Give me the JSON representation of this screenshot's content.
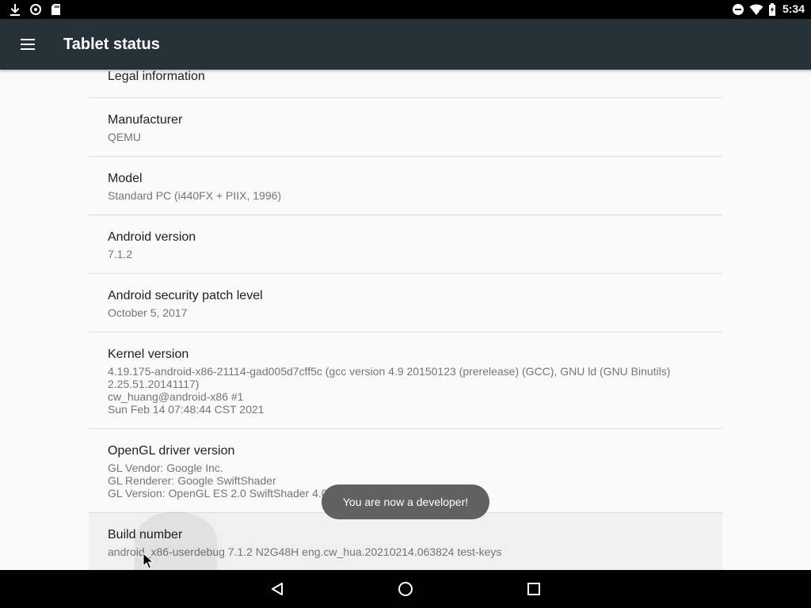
{
  "status_bar": {
    "time": "5:34",
    "left_icons": [
      "download-icon",
      "sync-icon",
      "sd-card-icon"
    ],
    "right_icons": [
      "do-not-disturb-icon",
      "wifi-icon",
      "battery-icon"
    ]
  },
  "toolbar": {
    "title": "Tablet status",
    "menu_icon": "hamburger-menu-icon"
  },
  "settings": [
    {
      "title": "Legal information",
      "summary": ""
    },
    {
      "title": "Manufacturer",
      "summary": "QEMU"
    },
    {
      "title": "Model",
      "summary": "Standard PC (i440FX + PIIX, 1996)"
    },
    {
      "title": "Android version",
      "summary": "7.1.2"
    },
    {
      "title": "Android security patch level",
      "summary": "October 5, 2017"
    },
    {
      "title": "Kernel version",
      "summary": "4.19.175-android-x86-21114-gad005d7cff5c (gcc version 4.9 20150123 (prerelease) (GCC), GNU ld (GNU Binutils)\n2.25.51.20141117)\ncw_huang@android-x86 #1\nSun Feb 14 07:48:44 CST 2021"
    },
    {
      "title": "OpenGL driver version",
      "summary": "GL Vendor: Google Inc.\nGL Renderer: Google SwiftShader\nGL Version: OpenGL ES 2.0 SwiftShader 4.0.0"
    },
    {
      "title": "Build number",
      "summary": "android_x86-userdebug 7.1.2 N2G48H eng.cw_hua.20210214.063824 test-keys"
    }
  ],
  "toast": {
    "message": "You are now a developer!"
  },
  "nav_bar": {
    "buttons": [
      "back-icon",
      "home-icon",
      "recents-icon"
    ]
  },
  "colors": {
    "toolbar": "#263238",
    "background": "#fafafa",
    "toast": "#616161"
  }
}
